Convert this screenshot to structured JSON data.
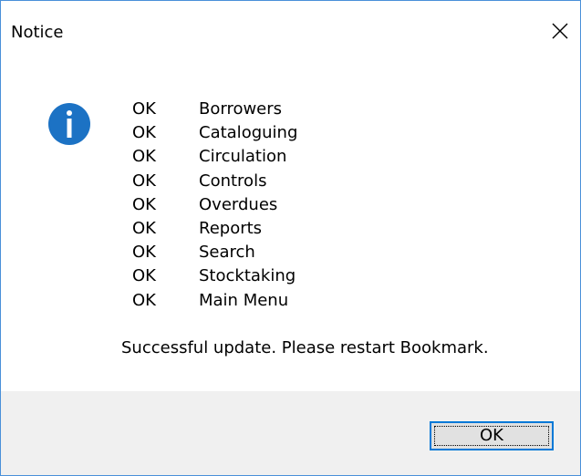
{
  "window": {
    "title": "Notice"
  },
  "icons": {
    "close": "close-icon",
    "info": "info-icon"
  },
  "colors": {
    "info_icon": "#1c72c4",
    "button_border": "#0078d7",
    "footer_background": "#f0f0f0",
    "window_border": "#4a90d9"
  },
  "modules": [
    {
      "status": "OK",
      "name": "Borrowers"
    },
    {
      "status": "OK",
      "name": "Cataloguing"
    },
    {
      "status": "OK",
      "name": "Circulation"
    },
    {
      "status": "OK",
      "name": "Controls"
    },
    {
      "status": "OK",
      "name": "Overdues"
    },
    {
      "status": "OK",
      "name": "Reports"
    },
    {
      "status": "OK",
      "name": "Search"
    },
    {
      "status": "OK",
      "name": "Stocktaking"
    },
    {
      "status": "OK",
      "name": "Main Menu"
    }
  ],
  "message": "Successful update. Please restart Bookmark.",
  "buttons": {
    "ok_label": "OK"
  }
}
